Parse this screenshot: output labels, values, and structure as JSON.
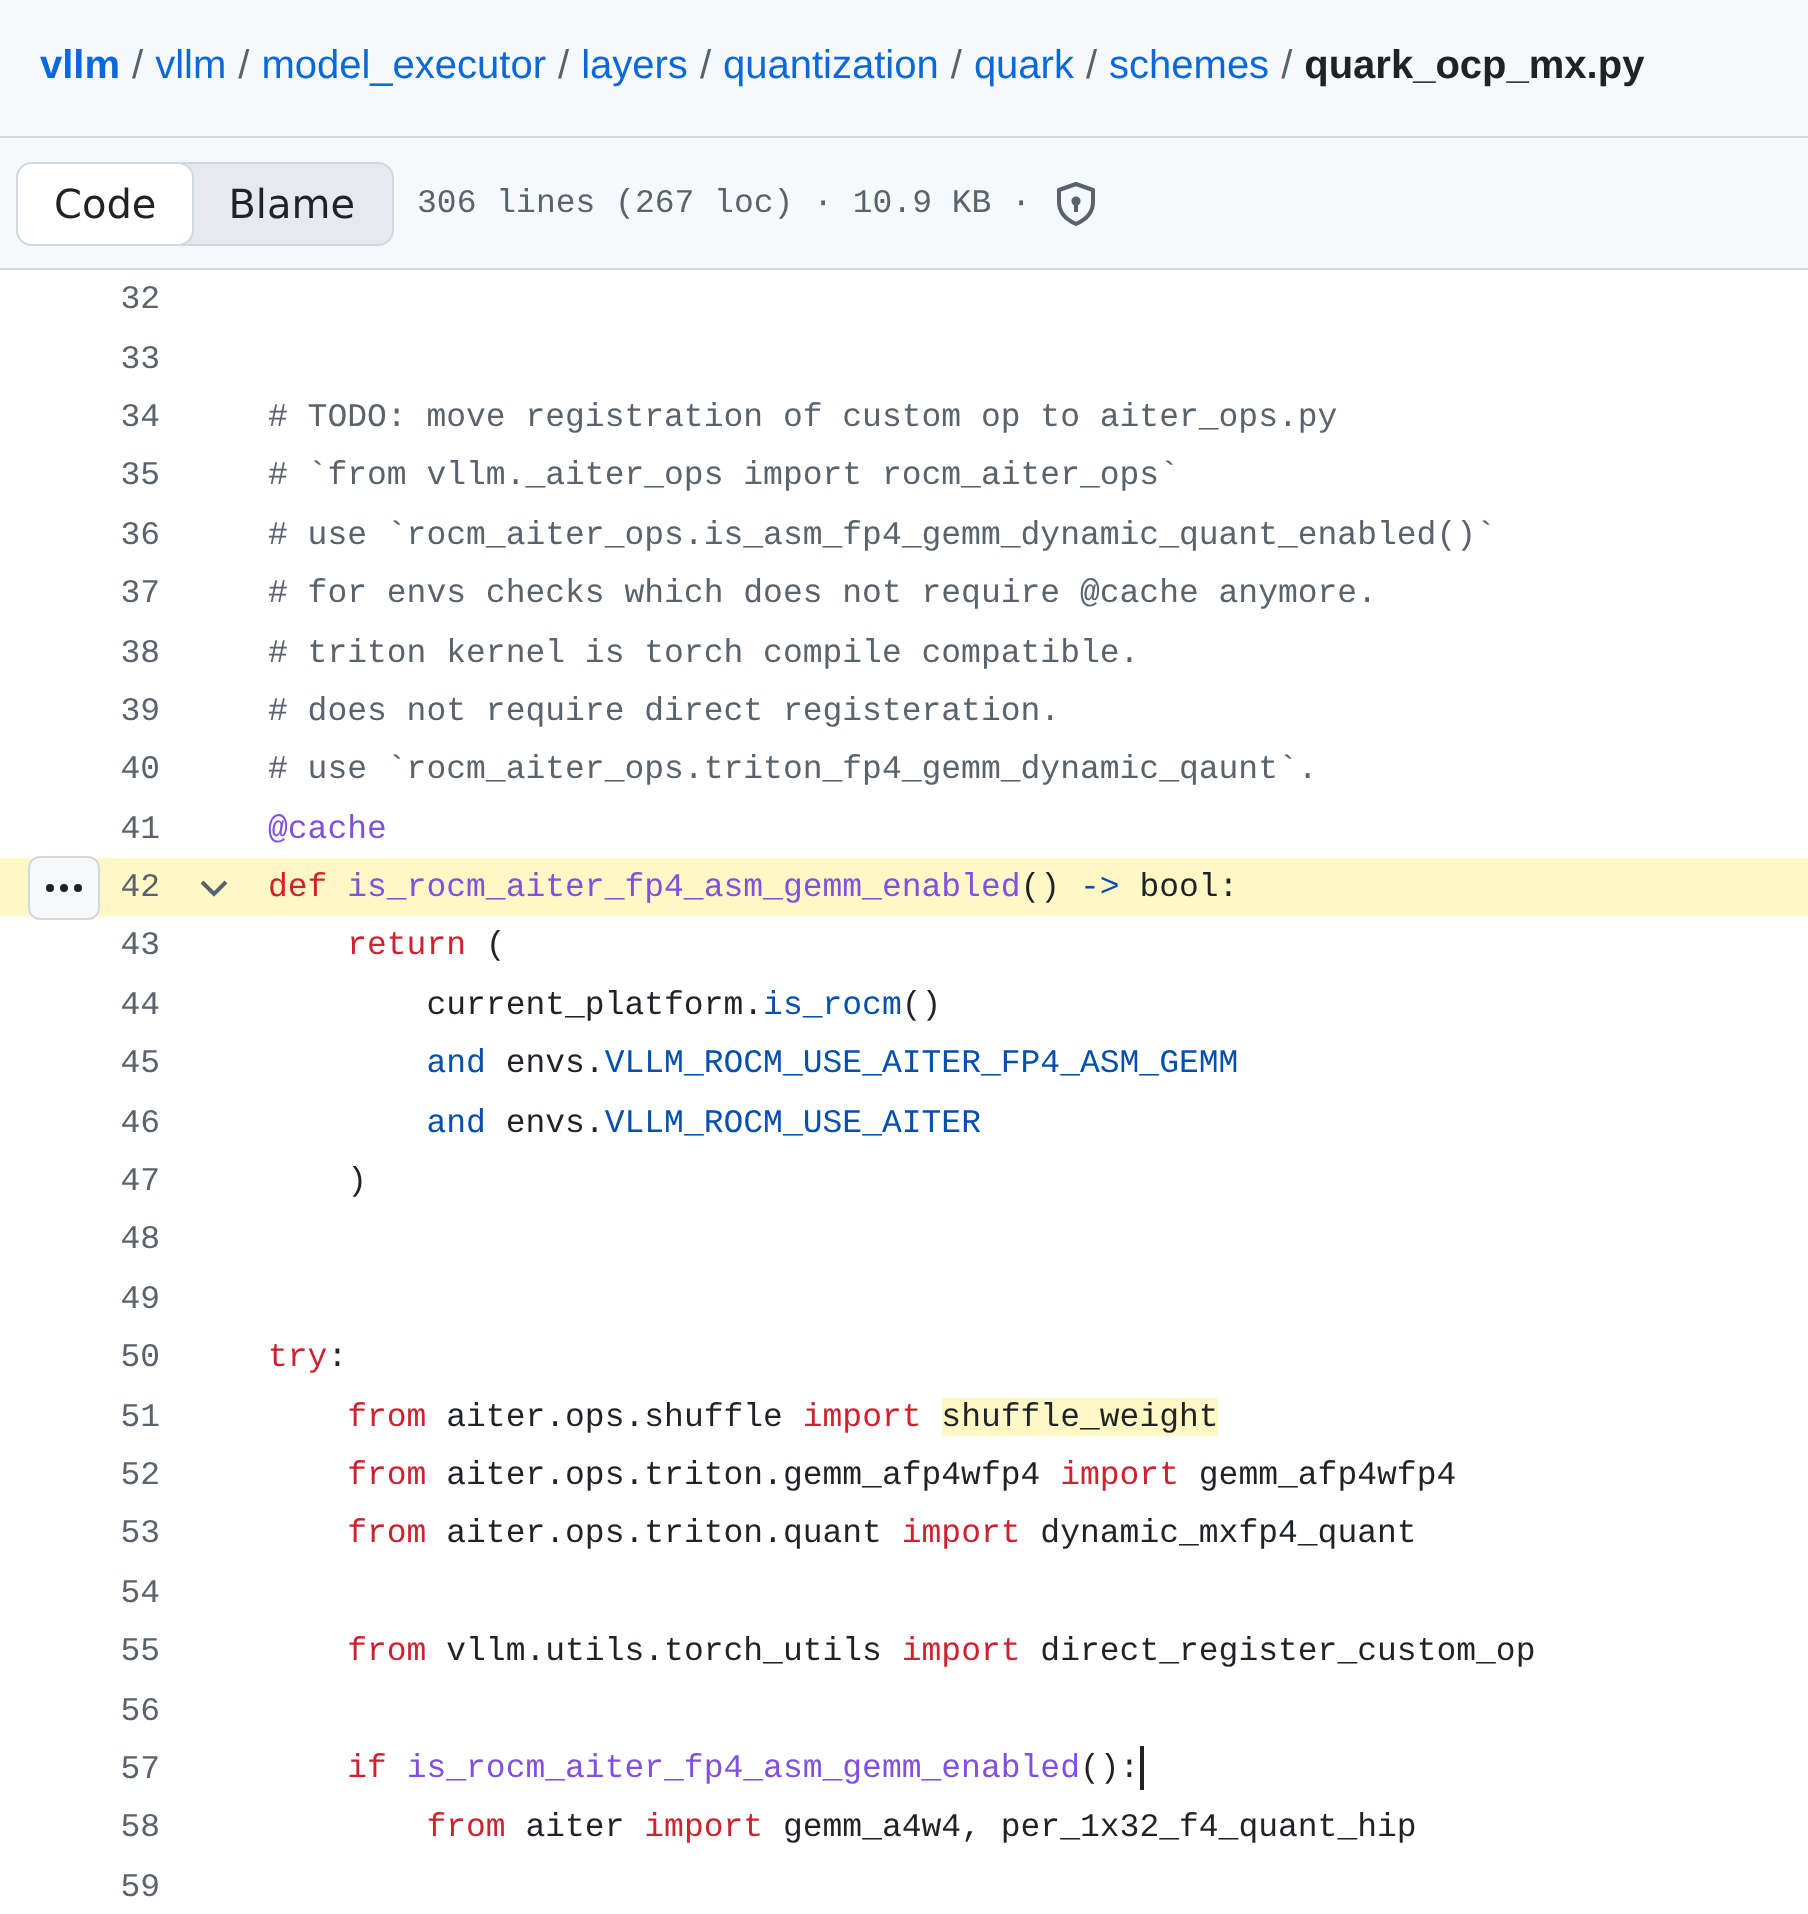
{
  "breadcrumb": [
    {
      "label": "vllm",
      "kind": "root"
    },
    {
      "label": "vllm",
      "kind": "link"
    },
    {
      "label": "model_executor",
      "kind": "link"
    },
    {
      "label": "layers",
      "kind": "link"
    },
    {
      "label": "quantization",
      "kind": "link"
    },
    {
      "label": "quark",
      "kind": "link"
    },
    {
      "label": "schemes",
      "kind": "link"
    },
    {
      "label": "quark_ocp_mx.py",
      "kind": "current"
    }
  ],
  "separator": "/",
  "tabs": [
    {
      "label": "Code",
      "selected": true
    },
    {
      "label": "Blame",
      "selected": false
    }
  ],
  "file_info": "306 lines (267 loc) · 10.9 KB ·",
  "lines": [
    {
      "n": "32",
      "highlighted": false,
      "foldable": false
    },
    {
      "n": "33",
      "highlighted": false,
      "foldable": false
    },
    {
      "n": "34",
      "highlighted": false,
      "foldable": false,
      "tokens": [
        {
          "t": "# TODO: move registration of custom op to aiter_ops.py",
          "kind": "comment"
        }
      ]
    },
    {
      "n": "35",
      "highlighted": false,
      "foldable": false,
      "tokens": [
        {
          "t": "# `from vllm._aiter_ops import rocm_aiter_ops`",
          "kind": "comment"
        }
      ]
    },
    {
      "n": "36",
      "highlighted": false,
      "foldable": false,
      "tokens": [
        {
          "t": "# use `rocm_aiter_ops.is_asm_fp4_gemm_dynamic_quant_enabled()`",
          "kind": "comment"
        }
      ]
    },
    {
      "n": "37",
      "highlighted": false,
      "foldable": false,
      "tokens": [
        {
          "t": "# for envs checks which does not require @cache anymore.",
          "kind": "comment"
        }
      ]
    },
    {
      "n": "38",
      "highlighted": false,
      "foldable": false,
      "tokens": [
        {
          "t": "# triton kernel is torch compile compatible.",
          "kind": "comment"
        }
      ]
    },
    {
      "n": "39",
      "highlighted": false,
      "foldable": false,
      "tokens": [
        {
          "t": "# does not require direct registeration.",
          "kind": "comment"
        }
      ]
    },
    {
      "n": "40",
      "highlighted": false,
      "foldable": false,
      "tokens": [
        {
          "t": "# use `rocm_aiter_ops.triton_fp4_gemm_dynamic_qaunt`.",
          "kind": "comment"
        }
      ]
    },
    {
      "n": "41",
      "highlighted": false,
      "foldable": false,
      "tokens": [
        {
          "t": "@cache",
          "kind": "function"
        }
      ]
    },
    {
      "n": "42",
      "highlighted": true,
      "foldable": true,
      "tokens": [
        {
          "t": "def ",
          "kind": "keyword"
        },
        {
          "t": "is_rocm_aiter_fp4_asm_gemm_enabled",
          "kind": "function"
        },
        {
          "t": "() ",
          "kind": "plain"
        },
        {
          "t": "->",
          "kind": "constant"
        },
        {
          "t": " bool:",
          "kind": "plain"
        }
      ]
    },
    {
      "n": "43",
      "highlighted": false,
      "foldable": false,
      "tokens": [
        {
          "t": "    return",
          "kind": "keyword"
        },
        {
          "t": " (",
          "kind": "plain"
        }
      ]
    },
    {
      "n": "44",
      "highlighted": false,
      "foldable": false,
      "tokens": [
        {
          "t": "        current_platform.",
          "kind": "plain"
        },
        {
          "t": "is_rocm",
          "kind": "constant"
        },
        {
          "t": "()",
          "kind": "plain"
        }
      ]
    },
    {
      "n": "45",
      "highlighted": false,
      "foldable": false,
      "tokens": [
        {
          "t": "        and",
          "kind": "constant"
        },
        {
          "t": " envs.",
          "kind": "plain"
        },
        {
          "t": "VLLM_ROCM_USE_AITER_FP4_ASM_GEMM",
          "kind": "constant"
        }
      ]
    },
    {
      "n": "46",
      "highlighted": false,
      "foldable": false,
      "tokens": [
        {
          "t": "        and",
          "kind": "constant"
        },
        {
          "t": " envs.",
          "kind": "plain"
        },
        {
          "t": "VLLM_ROCM_USE_AITER",
          "kind": "constant"
        }
      ]
    },
    {
      "n": "47",
      "highlighted": false,
      "foldable": false,
      "tokens": [
        {
          "t": "    )",
          "kind": "plain"
        }
      ]
    },
    {
      "n": "48",
      "highlighted": false,
      "foldable": false
    },
    {
      "n": "49",
      "highlighted": false,
      "foldable": false
    },
    {
      "n": "50",
      "highlighted": false,
      "foldable": false,
      "tokens": [
        {
          "t": "try",
          "kind": "keyword"
        },
        {
          "t": ":",
          "kind": "plain"
        }
      ]
    },
    {
      "n": "51",
      "highlighted": false,
      "foldable": false,
      "tokens": [
        {
          "t": "    from",
          "kind": "keyword"
        },
        {
          "t": " aiter.ops.shuffle ",
          "kind": "plain"
        },
        {
          "t": "import ",
          "kind": "keyword"
        },
        {
          "t": "shuffle_weight",
          "kind": "match"
        }
      ]
    },
    {
      "n": "52",
      "highlighted": false,
      "foldable": false,
      "tokens": [
        {
          "t": "    from",
          "kind": "keyword"
        },
        {
          "t": " aiter.ops.triton.gemm_afp4wfp4 ",
          "kind": "plain"
        },
        {
          "t": "import",
          "kind": "keyword"
        },
        {
          "t": " gemm_afp4wfp4",
          "kind": "plain"
        }
      ]
    },
    {
      "n": "53",
      "highlighted": false,
      "foldable": false,
      "tokens": [
        {
          "t": "    from",
          "kind": "keyword"
        },
        {
          "t": " aiter.ops.triton.quant ",
          "kind": "plain"
        },
        {
          "t": "import",
          "kind": "keyword"
        },
        {
          "t": " dynamic_mxfp4_quant",
          "kind": "plain"
        }
      ]
    },
    {
      "n": "54",
      "highlighted": false,
      "foldable": false
    },
    {
      "n": "55",
      "highlighted": false,
      "foldable": false,
      "tokens": [
        {
          "t": "    from",
          "kind": "keyword"
        },
        {
          "t": " vllm.utils.torch_utils ",
          "kind": "plain"
        },
        {
          "t": "import",
          "kind": "keyword"
        },
        {
          "t": " direct_register_custom_op",
          "kind": "plain"
        }
      ]
    },
    {
      "n": "56",
      "highlighted": false,
      "foldable": false
    },
    {
      "n": "57",
      "highlighted": false,
      "foldable": false,
      "tokens": [
        {
          "t": "    if ",
          "kind": "keyword"
        },
        {
          "t": "is_rocm_aiter_fp4_asm_gemm_enabled",
          "kind": "function"
        },
        {
          "t": "():",
          "kind": "plain"
        },
        {
          "kind": "cursor"
        }
      ]
    },
    {
      "n": "58",
      "highlighted": false,
      "foldable": false,
      "tokens": [
        {
          "t": "        from",
          "kind": "keyword"
        },
        {
          "t": " aiter ",
          "kind": "plain"
        },
        {
          "t": "import",
          "kind": "keyword"
        },
        {
          "t": " gemm_a4w4, per_1x32_f4_quant_hip",
          "kind": "plain"
        }
      ]
    },
    {
      "n": "59",
      "highlighted": false,
      "foldable": false
    }
  ]
}
